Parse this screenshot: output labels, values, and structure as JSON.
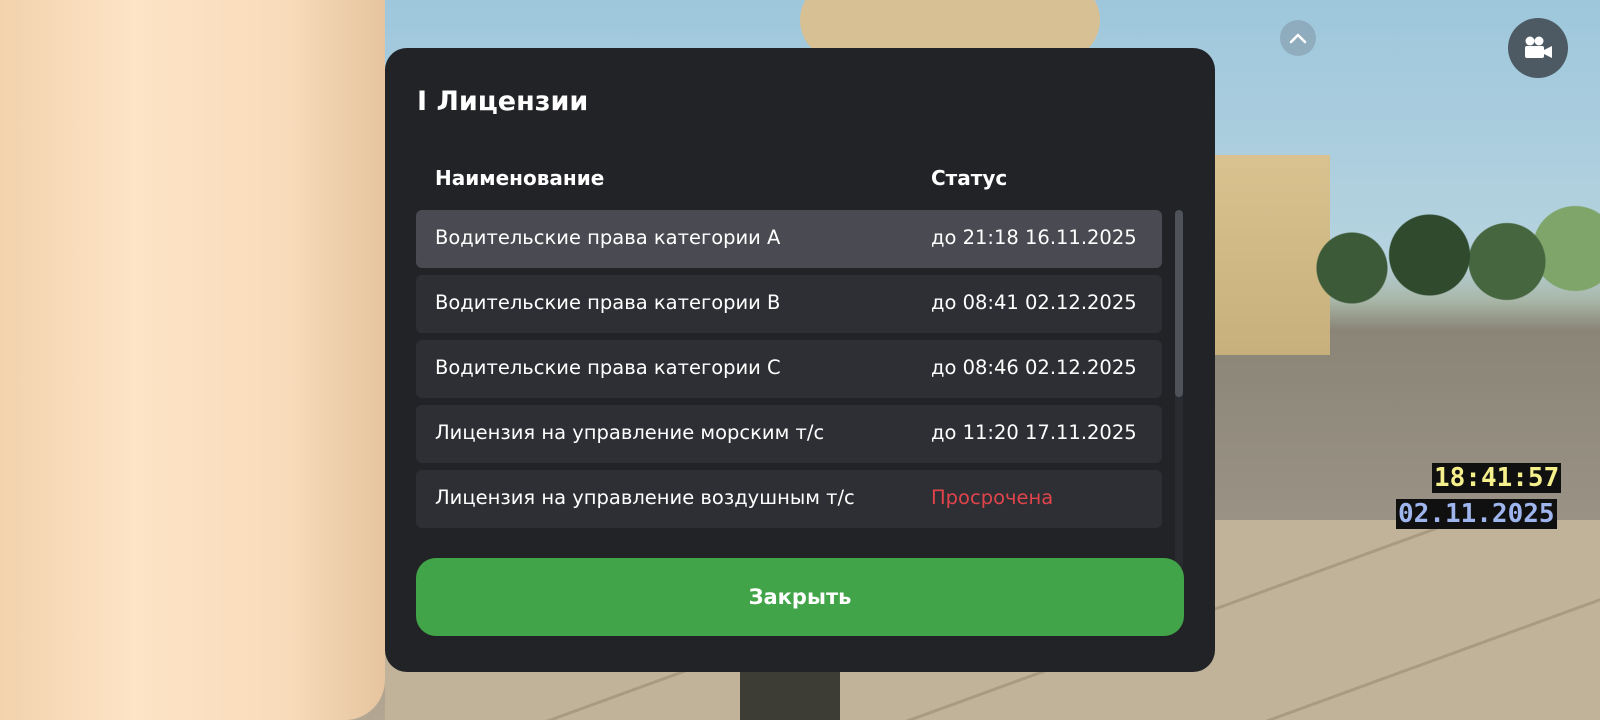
{
  "panel": {
    "title": "I Лицензии",
    "columns": {
      "name": "Наименование",
      "status": "Статус"
    },
    "rows": [
      {
        "name": "Водительские права категории A",
        "status": "до 21:18 16.11.2025",
        "expired": false,
        "selected": true
      },
      {
        "name": "Водительские права категории B",
        "status": "до 08:41 02.12.2025",
        "expired": false,
        "selected": false
      },
      {
        "name": "Водительские права категории C",
        "status": "до 08:46 02.12.2025",
        "expired": false,
        "selected": false
      },
      {
        "name": "Лицензия на управление морским т/с",
        "status": "до 11:20 17.11.2025",
        "expired": false,
        "selected": false
      },
      {
        "name": "Лицензия на управление воздушным т/с",
        "status": "Просрочена",
        "expired": true,
        "selected": false
      }
    ],
    "close_label": "Закрыть"
  },
  "hud": {
    "time": "18:41:57",
    "date": "02.11.2025"
  },
  "icons": {
    "collapse": "chevron-up-icon",
    "camera": "video-camera-icon"
  },
  "colors": {
    "accent_green": "#42a449",
    "expired_red": "#e0444a",
    "panel_bg": "#222327"
  }
}
